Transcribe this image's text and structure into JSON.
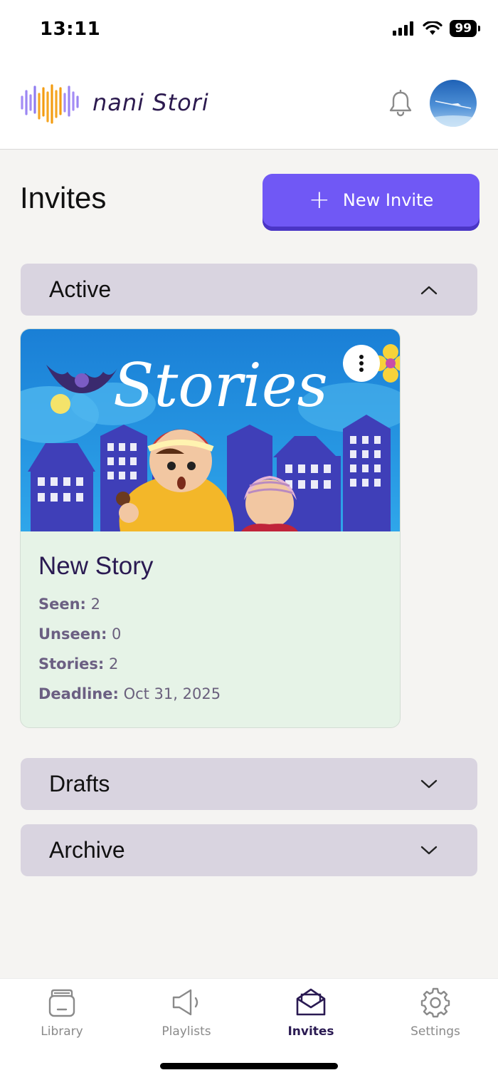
{
  "status_bar": {
    "time": "13:11",
    "battery": "99"
  },
  "header": {
    "app_name": "nani Stori"
  },
  "page": {
    "title": "Invites",
    "new_invite_label": "New Invite"
  },
  "sections": {
    "active": "Active",
    "drafts": "Drafts",
    "archive": "Archive"
  },
  "card": {
    "image_text": "Stories",
    "title": "New Story",
    "seen_label": "Seen:",
    "seen_value": "2",
    "unseen_label": "Unseen:",
    "unseen_value": "0",
    "stories_label": "Stories:",
    "stories_value": "2",
    "deadline_label": "Deadline:",
    "deadline_value": "Oct 31, 2025"
  },
  "nav": {
    "items": [
      {
        "label": "Library",
        "icon": "library-icon"
      },
      {
        "label": "Playlists",
        "icon": "megaphone-icon"
      },
      {
        "label": "Invites",
        "icon": "envelope-icon",
        "active": true
      },
      {
        "label": "Settings",
        "icon": "gear-icon"
      }
    ]
  },
  "colors": {
    "accent": "#7058f5",
    "section_bg": "#d9d4e0",
    "card_bg": "#e6f3e7",
    "title_text": "#2a1a52"
  }
}
